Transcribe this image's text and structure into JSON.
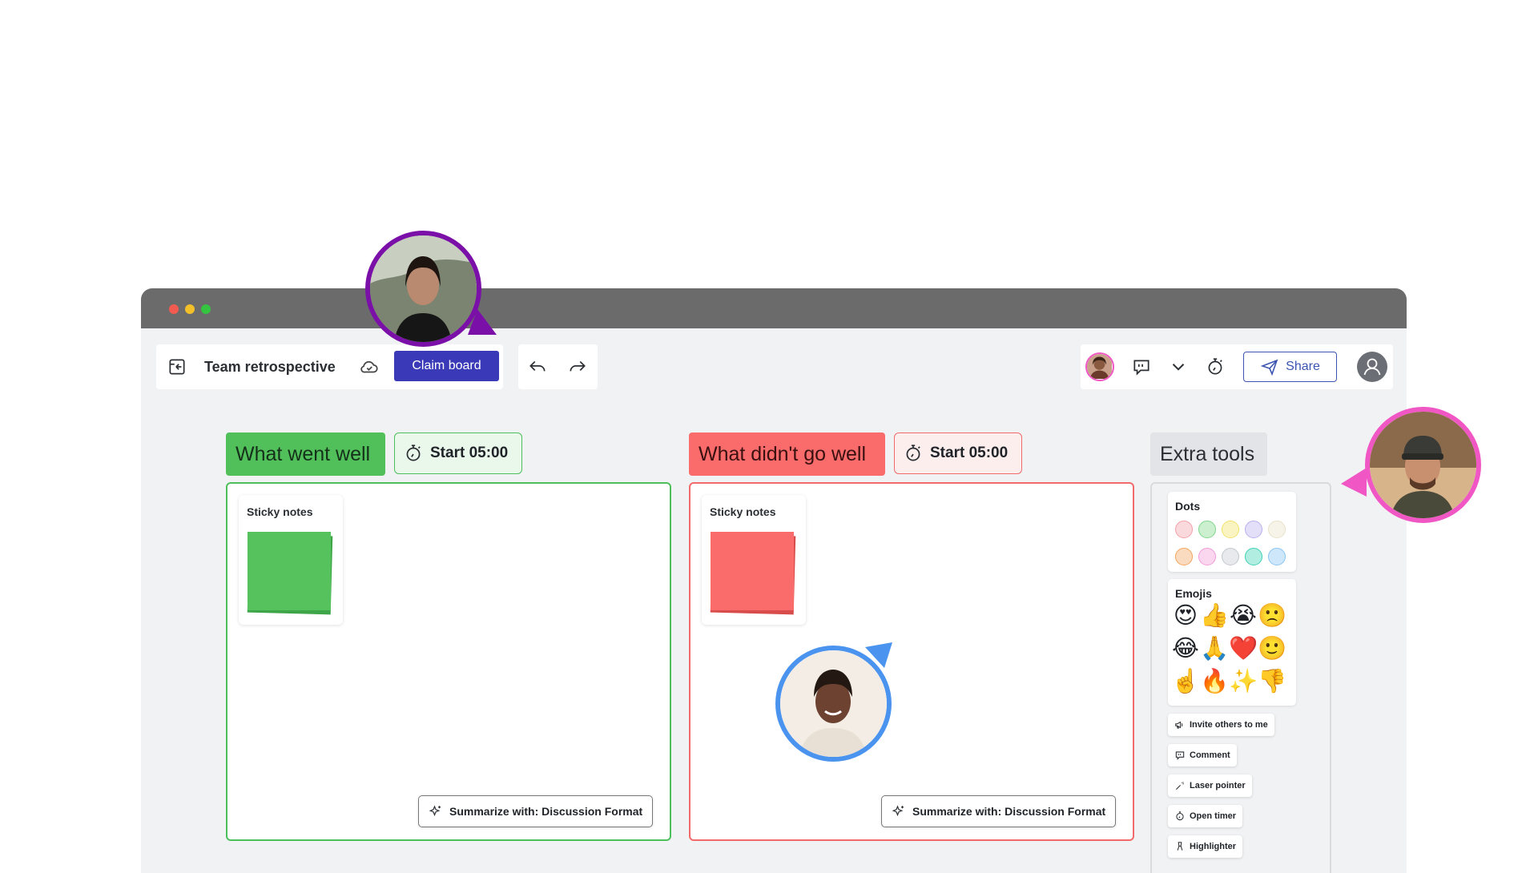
{
  "toolbar": {
    "board_title": "Team retrospective",
    "claim_label": "Claim board",
    "share_label": "Share"
  },
  "columns": [
    {
      "title": "What went well",
      "timer_label": "Start 05:00",
      "sticky_label": "Sticky notes",
      "summarize_label": "Summarize with: Discussion Format",
      "accent": "#4cc05a",
      "sticky_color": "#52c05a"
    },
    {
      "title": "What didn't go well",
      "timer_label": "Start 05:00",
      "sticky_label": "Sticky notes",
      "summarize_label": "Summarize with: Discussion Format",
      "accent": "#f26a6a",
      "sticky_color": "#fa6b6b"
    }
  ],
  "extra_tools": {
    "title": "Extra tools",
    "dots_title": "Dots",
    "dot_colors": [
      "#f3a0a8",
      "#7fd68a",
      "#f3e36a",
      "#b8b0f0",
      "#e8e2c8",
      "#f3a55e",
      "#f39ad8",
      "#c4c8cf",
      "#3ed1b3",
      "#88c4f3"
    ],
    "emojis_title": "Emojis",
    "emojis": [
      "😍",
      "👍",
      "😭",
      "🙁",
      "😂",
      "🙏",
      "❤️",
      "🙂",
      "☝️",
      "🔥",
      "✨",
      "👎"
    ],
    "tools": [
      {
        "label": "Invite others to me",
        "icon": "megaphone-icon"
      },
      {
        "label": "Comment",
        "icon": "comment-icon"
      },
      {
        "label": "Laser pointer",
        "icon": "laser-pointer-icon"
      },
      {
        "label": "Open timer",
        "icon": "timer-icon"
      },
      {
        "label": "Highlighter",
        "icon": "highlighter-icon"
      }
    ]
  },
  "colors": {
    "claim_button": "#3a3ab8",
    "share_border": "#3d55b0",
    "cursor_purple": "#7a10a8",
    "cursor_blue": "#4a94f0",
    "cursor_pink": "#f057c4"
  }
}
